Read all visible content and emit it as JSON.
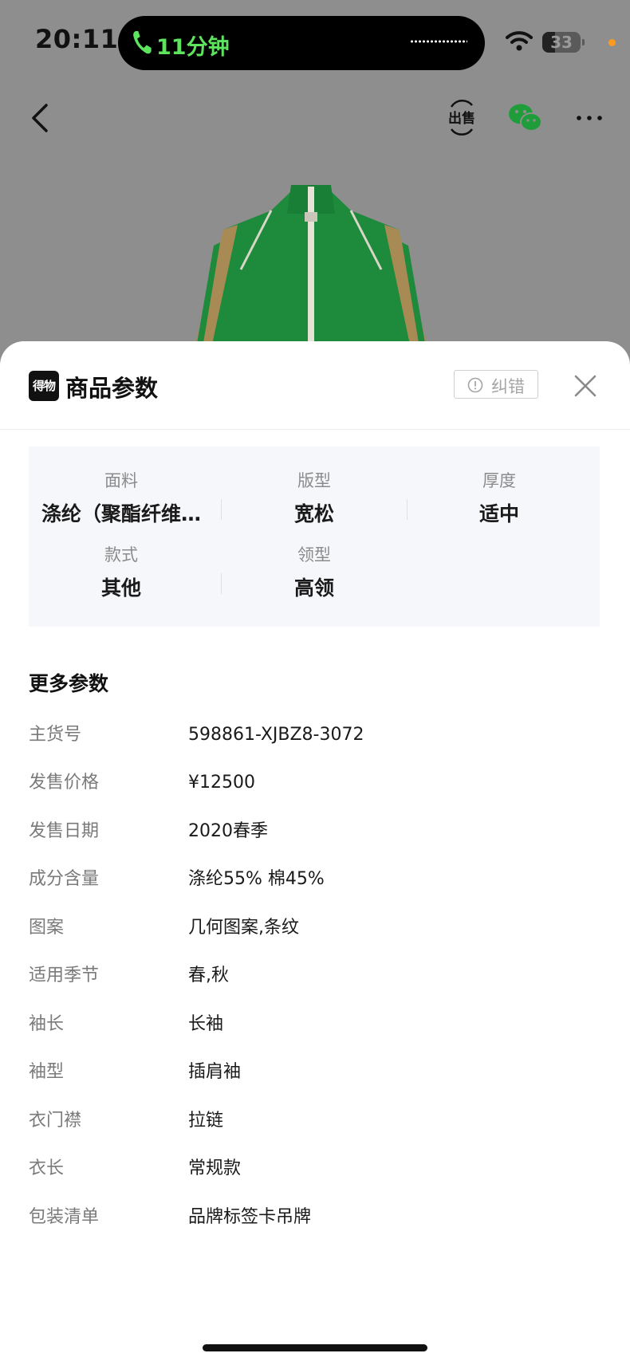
{
  "status_bar": {
    "time": "20:11",
    "call_duration": "11分钟",
    "battery": "33",
    "battery_level": 0.33
  },
  "nav": {
    "sell_icon_label": "出售",
    "icons": [
      "back-arrow-icon",
      "sell-icon",
      "wechat-icon",
      "more-icon"
    ]
  },
  "sheet": {
    "logo_text": "得物",
    "title": "商品参数",
    "report_label": "纠错",
    "key_params": [
      {
        "label": "面料",
        "value": "涤纶（聚酯纤维…"
      },
      {
        "label": "版型",
        "value": "宽松"
      },
      {
        "label": "厚度",
        "value": "适中"
      },
      {
        "label": "款式",
        "value": "其他"
      },
      {
        "label": "领型",
        "value": "高领"
      }
    ],
    "more_title": "更多参数",
    "more_params": [
      {
        "label": "主货号",
        "value": "598861-XJBZ8-3072"
      },
      {
        "label": "发售价格",
        "value": "¥12500"
      },
      {
        "label": "发售日期",
        "value": "2020春季"
      },
      {
        "label": "成分含量",
        "value": "涤纶55% 棉45%"
      },
      {
        "label": "图案",
        "value": "几何图案,条纹"
      },
      {
        "label": "适用季节",
        "value": "春,秋"
      },
      {
        "label": "袖长",
        "value": "长袖"
      },
      {
        "label": "袖型",
        "value": "插肩袖"
      },
      {
        "label": "衣门襟",
        "value": "拉链"
      },
      {
        "label": "衣长",
        "value": "常规款"
      },
      {
        "label": "包装清单",
        "value": "品牌标签卡吊牌"
      }
    ]
  },
  "colors": {
    "overlay": "#8b8b8b",
    "call_green": "#5ee35e",
    "jacket_green": "#1e8a3c",
    "jacket_stripe": "#a88a55",
    "key_box_bg": "#f6f7fa"
  }
}
